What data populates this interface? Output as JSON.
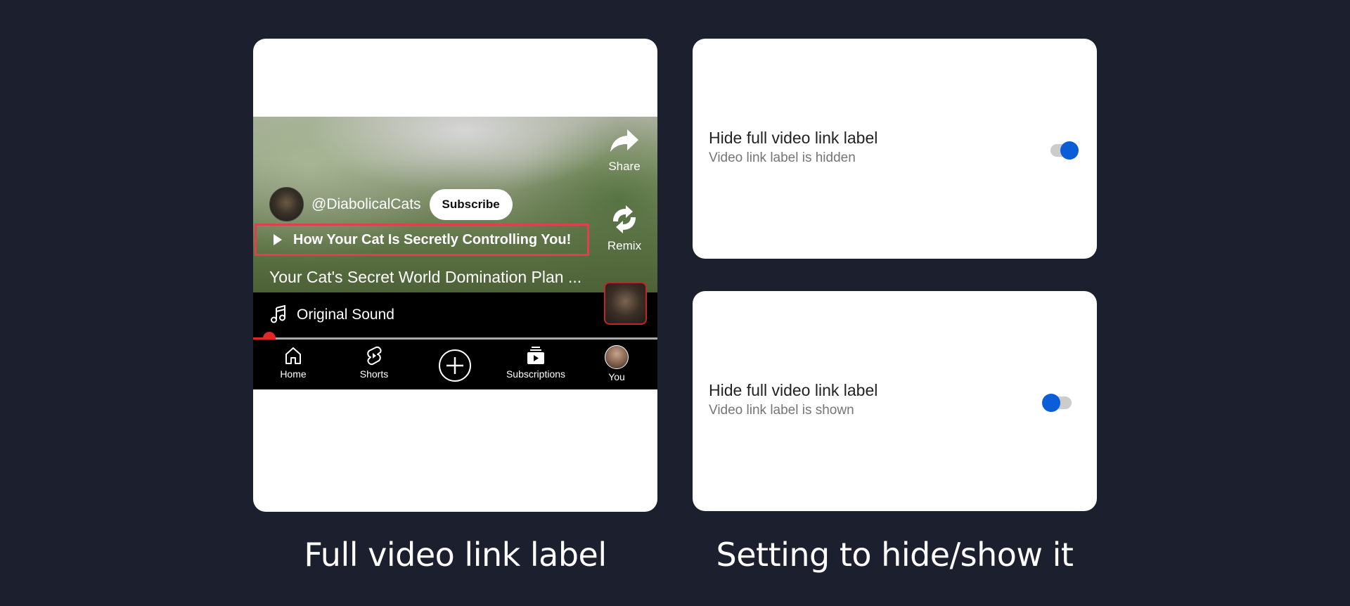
{
  "left_card": {
    "channel_name": "@DiabolicalCats",
    "subscribe_label": "Subscribe",
    "full_video_link_label": "How Your Cat Is Secretly Controlling You!",
    "video_title": "Your Cat's Secret World Domination Plan ...",
    "sound_label": "Original Sound",
    "share_label": "Share",
    "remix_label": "Remix",
    "highlight_color": "#e0404c",
    "progress_fraction": 0.04,
    "nav": {
      "home": "Home",
      "shorts": "Shorts",
      "subscriptions": "Subscriptions",
      "you": "You"
    }
  },
  "settings": [
    {
      "title": "Hide full video link label",
      "subtitle": "Video link label is hidden",
      "enabled": true
    },
    {
      "title": "Hide full video link label",
      "subtitle": "Video link label is shown",
      "enabled": false
    }
  ],
  "toggle_color": "#0b5ed7",
  "captions": {
    "left": "Full video link label",
    "right": "Setting to hide/show it"
  }
}
